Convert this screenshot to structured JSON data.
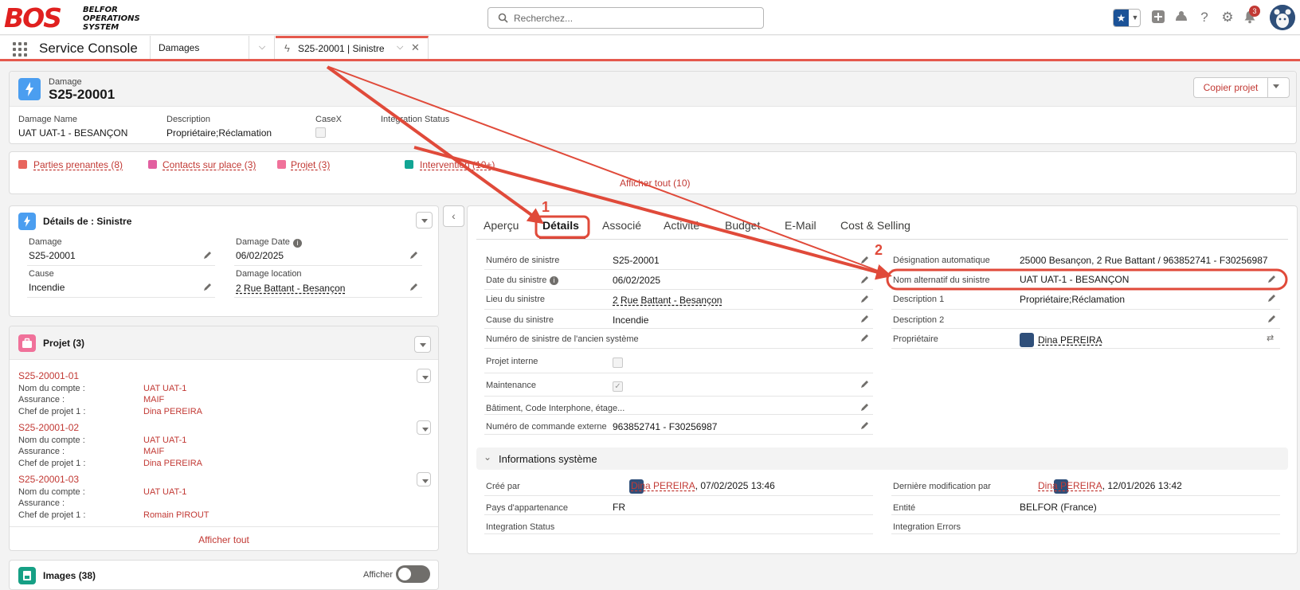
{
  "brand": {
    "logo_big": "BOS",
    "logo_small": [
      "BELFOR",
      "OPERATIONS",
      "SYSTEM"
    ]
  },
  "search": {
    "placeholder": "Recherchez..."
  },
  "header": {
    "notifications_count": "3"
  },
  "console": {
    "app_name": "Service Console",
    "tabs": [
      {
        "label": "Damages"
      },
      {
        "label": "S25-20001 | Sinistre"
      }
    ]
  },
  "record": {
    "type": "Damage",
    "title": "S25-20001",
    "action_button": "Copier projet",
    "highlights": [
      {
        "label": "Damage Name",
        "value": "UAT UAT-1 - BESANÇON"
      },
      {
        "label": "Description",
        "value": "Propriétaire;Réclamation"
      },
      {
        "label": "CaseX",
        "value": ""
      },
      {
        "label": "Integration Status",
        "value": ""
      }
    ]
  },
  "related_links": {
    "items": [
      "Parties prenantes (8)",
      "Contacts sur place (3)",
      "Projet (3)",
      "Intervention (10+)"
    ],
    "show_all": "Afficher tout (10)"
  },
  "details_card": {
    "title": "Détails de : Sinistre",
    "fields": [
      {
        "label": "Damage",
        "value": "S25-20001"
      },
      {
        "label": "Damage Date",
        "value": "06/02/2025"
      },
      {
        "label": "Cause",
        "value": "Incendie"
      },
      {
        "label": "Damage location",
        "value": "2 Rue Battant - Besançon"
      }
    ]
  },
  "projects_card": {
    "title": "Projet (3)",
    "labels": {
      "account": "Nom du compte :",
      "insurance": "Assurance :",
      "manager": "Chef de projet 1 :"
    },
    "items": [
      {
        "id": "S25-20001-01",
        "account": "UAT UAT-1",
        "insurance": "MAIF",
        "manager": "Dina PEREIRA"
      },
      {
        "id": "S25-20001-02",
        "account": "UAT UAT-1",
        "insurance": "MAIF",
        "manager": "Dina PEREIRA"
      },
      {
        "id": "S25-20001-03",
        "account": "UAT UAT-1",
        "insurance": "",
        "manager": "Romain PIROUT"
      }
    ],
    "show_all": "Afficher tout"
  },
  "images_card": {
    "title": "Images (38)",
    "toggle_label": "Afficher"
  },
  "detail_tabs": [
    "Aperçu",
    "Détails",
    "Associé",
    "Activité",
    "Budget",
    "E-Mail",
    "Cost & Selling"
  ],
  "detail_fields_left": [
    {
      "label": "Numéro de sinistre",
      "value": "S25-20001"
    },
    {
      "label": "Date du sinistre",
      "value": "06/02/2025"
    },
    {
      "label": "Lieu du sinistre",
      "value": "2 Rue Battant - Besançon"
    },
    {
      "label": "Cause du sinistre",
      "value": "Incendie"
    },
    {
      "label": "Numéro de sinistre de l'ancien système",
      "value": ""
    },
    {
      "label": "Projet interne",
      "value": ""
    },
    {
      "label": "Maintenance",
      "value": ""
    },
    {
      "label": "Bâtiment, Code Interphone, étage...",
      "value": ""
    },
    {
      "label": "Numéro de commande externe",
      "value": "963852741 - F30256987"
    }
  ],
  "detail_fields_right": [
    {
      "label": "Désignation automatique",
      "value": "25000 Besançon, 2 Rue Battant / 963852741 - F30256987"
    },
    {
      "label": "Nom alternatif du sinistre",
      "value": "UAT UAT-1 - BESANÇON"
    },
    {
      "label": "Description 1",
      "value": "Propriétaire;Réclamation"
    },
    {
      "label": "Description 2",
      "value": ""
    },
    {
      "label": "Propriétaire",
      "value": "Dina PEREIRA"
    }
  ],
  "system_section": {
    "title": "Informations système",
    "created_by_label": "Créé par",
    "created_by_user": "Dina PEREIRA",
    "created_by_date": ", 07/02/2025 13:46",
    "modified_by_label": "Dernière modification par",
    "modified_by_user": "Dina PEREIRA",
    "modified_by_date": ", 12/01/2026 13:42",
    "country_label": "Pays d'appartenance",
    "country_value": "FR",
    "entity_label": "Entité",
    "entity_value": "BELFOR (France)",
    "integration_status_label": "Integration Status",
    "integration_errors_label": "Integration Errors"
  },
  "annotations": {
    "step1": "1",
    "step2": "2"
  },
  "colors": {
    "brand_red": "#e0201f",
    "annotation_red": "#e04a3a",
    "link_red": "#c23934",
    "accent_blue": "#1b5297"
  }
}
